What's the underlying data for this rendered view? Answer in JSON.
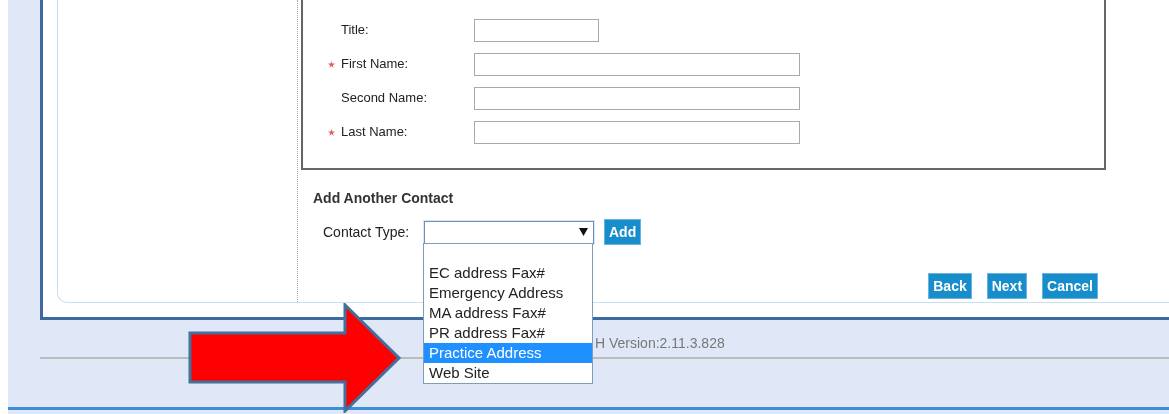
{
  "person_form": {
    "fields": [
      {
        "label": "Title:",
        "required": false,
        "kind": "short"
      },
      {
        "label": "First Name:",
        "required": true,
        "kind": "text"
      },
      {
        "label": "Second Name:",
        "required": false,
        "kind": "text"
      },
      {
        "label": "Last Name:",
        "required": true,
        "kind": "text"
      }
    ]
  },
  "add_contact": {
    "heading": "Add Another Contact",
    "label": "Contact Type:",
    "expanded": true,
    "add_button": "Add",
    "options": [
      {
        "label": "EC address Fax#",
        "selected": false
      },
      {
        "label": "Emergency Address",
        "selected": false
      },
      {
        "label": "MA address Fax#",
        "selected": false
      },
      {
        "label": "PR address Fax#",
        "selected": false
      },
      {
        "label": "Practice Address",
        "selected": true
      },
      {
        "label": "Web Site",
        "selected": false
      }
    ]
  },
  "nav_buttons": [
    "Back",
    "Next",
    "Cancel"
  ],
  "footer": {
    "version": "H Version:2.11.3.828"
  }
}
